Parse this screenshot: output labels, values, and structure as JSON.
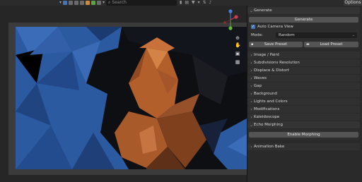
{
  "header": {
    "search_placeholder": "Search",
    "options_label": "Options"
  },
  "colors": {
    "accent": "#4772b3",
    "panel_bg": "#2a2a2a",
    "artwork_blue": "#2d5fa8",
    "artwork_orange": "#b5622e"
  },
  "sidebar": {
    "generate": {
      "title": "Generate",
      "generate_button": "Generate",
      "auto_camera_label": "Auto Camera View",
      "auto_camera_checked": true,
      "mode_label": "Mode:",
      "mode_value": "Random",
      "save_preset_button": "Save Preset",
      "load_preset_button": "Load Preset"
    },
    "panels": [
      "Image / Paint",
      "Subdivisions Resolution",
      "Displace & Distort",
      "Waves",
      "Gap",
      "Background",
      "Lights and Colors",
      "Modifications",
      "Kaleidoscope"
    ],
    "echo": {
      "title": "Echo Morphing",
      "enable_button": "Enable Morphing"
    },
    "animation_bake": "Animation Bake"
  },
  "gizmo": {
    "axes": [
      "X",
      "Y",
      "Z"
    ]
  }
}
